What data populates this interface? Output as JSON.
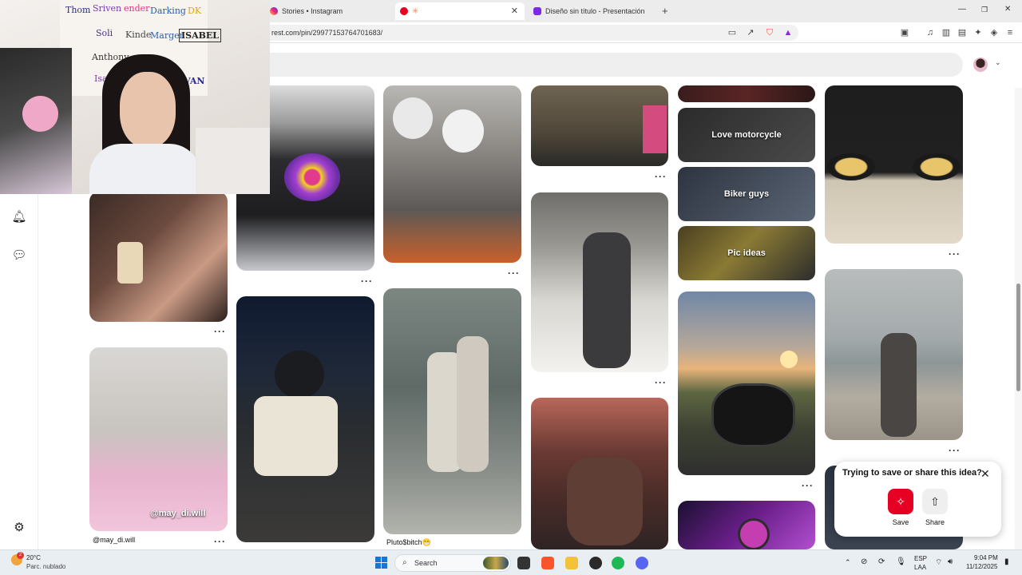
{
  "browser": {
    "tabs": [
      {
        "title": "Stories • Instagram",
        "active": false
      },
      {
        "title": "",
        "active": true
      },
      {
        "title": "Diseño sin título - Presentación",
        "active": false
      }
    ],
    "new_tab": "+",
    "url": "rest.com/pin/299771537647016​83/",
    "window_controls": {
      "minimize": "—",
      "restore": "❐",
      "close": "✕"
    }
  },
  "pinterest": {
    "pins": [
      {
        "caption": "",
        "dots": "···"
      },
      {
        "caption": "",
        "dots": "···"
      },
      {
        "caption": "@may_di.will",
        "overlay": "@may_di.will",
        "dots": "···"
      },
      {
        "caption": "",
        "dots": "···"
      },
      {
        "caption": "Pluto$bitch😁",
        "dots": "···"
      },
      {
        "caption": "",
        "dots": "···"
      },
      {
        "caption": "",
        "dots": "···"
      },
      {
        "caption": "",
        "dots": "···"
      },
      {
        "caption": "",
        "dots": "···"
      }
    ],
    "boards": [
      {
        "label": "Love motorcycle"
      },
      {
        "label": "Biker guys"
      },
      {
        "label": "Pic ideas"
      }
    ],
    "popup": {
      "title": "Trying to save or share this idea?",
      "save_label": "Save",
      "share_label": "Share",
      "accent": "#e60023"
    }
  },
  "webcam": {
    "wall_names": [
      "Thom",
      "Sriven",
      "ender",
      "Darking",
      "DK",
      "Soli",
      "Kinde",
      "Marger",
      "ISABEL",
      "Anthony",
      "IVAN",
      "Isa"
    ]
  },
  "taskbar": {
    "weather_temp": "20°C",
    "weather_desc": "Parc. nublado",
    "weather_badge": "2",
    "search_placeholder": "Search",
    "lang_top": "ESP",
    "lang_bottom": "LAA",
    "time": "9:04 PM",
    "date": "11/12/2025"
  }
}
